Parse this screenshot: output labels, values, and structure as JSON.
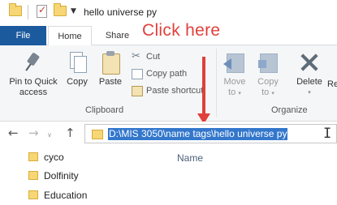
{
  "window": {
    "title": "hello universe py"
  },
  "quick_access": {
    "icons": [
      "folder-icon",
      "properties-icon",
      "new-folder-icon",
      "customize-dropdown-icon"
    ],
    "dropdown_glyph": "▼"
  },
  "tabs": [
    {
      "label": "File",
      "color": "#1c5a9e"
    },
    {
      "label": "Home",
      "active": true
    },
    {
      "label": "Share"
    }
  ],
  "annotation": {
    "text": "Click here",
    "color": "#e0403b"
  },
  "ribbon": {
    "clipboard": {
      "label": "Clipboard",
      "pin_label_line1": "Pin to Quick",
      "pin_label_line2": "access",
      "copy_label": "Copy",
      "paste_label": "Paste",
      "cut_label": "Cut",
      "copy_path_label": "Copy path",
      "paste_shortcut_label": "Paste shortcut"
    },
    "organize": {
      "label": "Organize",
      "move_to_line1": "Move",
      "move_to_line2": "to",
      "copy_to_line1": "Copy",
      "copy_to_line2": "to",
      "delete_label": "Delete",
      "rename_label": "Re"
    },
    "dropdown_glyph": "▾"
  },
  "navigation": {
    "back_glyph": "←",
    "forward_glyph": "→",
    "recent_glyph": "∨",
    "up_glyph": "↑",
    "address": "D:\\MIS 3050\\name tags\\hello universe py",
    "selection_color": "#3377cc"
  },
  "nav_pane": {
    "items": [
      "cyco",
      "Dolfinity",
      "Education"
    ]
  },
  "file_list": {
    "column_name": "Name"
  }
}
